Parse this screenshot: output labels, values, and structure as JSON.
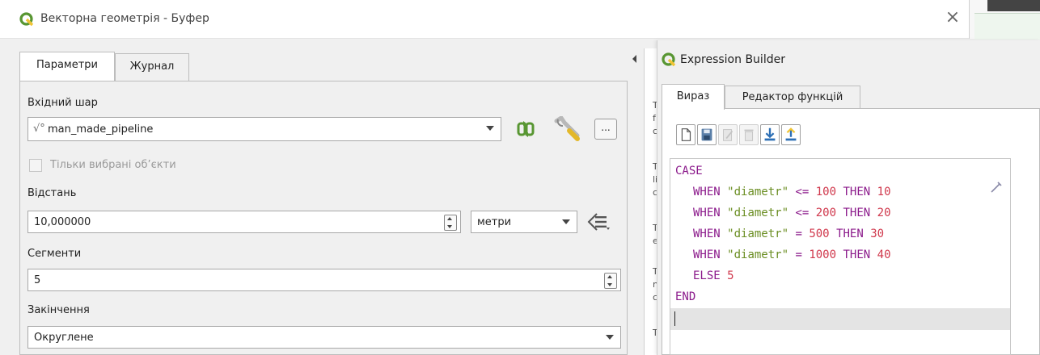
{
  "dialog": {
    "title": "Векторна геометрія - Буфер",
    "tabs": [
      "Параметри",
      "Журнал"
    ],
    "input_layer": {
      "label": "Вхідний шар",
      "value": "man_made_pipeline"
    },
    "selected_only": {
      "label": "Тільки вибрані об’єкти",
      "checked": false
    },
    "distance": {
      "label": "Відстань",
      "value": "10,000000",
      "unit": "метри"
    },
    "segments": {
      "label": "Сегменти",
      "value": "5"
    },
    "end_cap": {
      "label": "Закінчення",
      "value": "Округлене"
    },
    "browse_label": "..."
  },
  "expression_builder": {
    "title": "Expression Builder",
    "tabs": [
      "Вираз",
      "Редактор функцій"
    ],
    "code": {
      "l1_kw": "CASE",
      "when": "WHEN",
      "then": "THEN",
      "field": "\"diametr\"",
      "lines": [
        {
          "op": "<=",
          "value": "100",
          "result": "10"
        },
        {
          "op": "<=",
          "value": "200",
          "result": "20"
        },
        {
          "op": "=",
          "value": "500",
          "result": "30"
        },
        {
          "op": "=",
          "value": "1000",
          "result": "40"
        }
      ],
      "else_kw": "ELSE",
      "else_value": "5",
      "end_kw": "END"
    }
  },
  "help_pane": {
    "letters": [
      "T",
      "f",
      "c",
      "T",
      "li",
      "c",
      "T",
      "e",
      "T",
      "n",
      "c",
      "T"
    ]
  },
  "colors": {
    "qgis_green": "#589632",
    "qgis_yellow": "#f0c434",
    "keyword": "#8b1a8b",
    "string": "#6b8e23",
    "number": "#d0384c",
    "icon_blue": "#2d6fb5"
  }
}
